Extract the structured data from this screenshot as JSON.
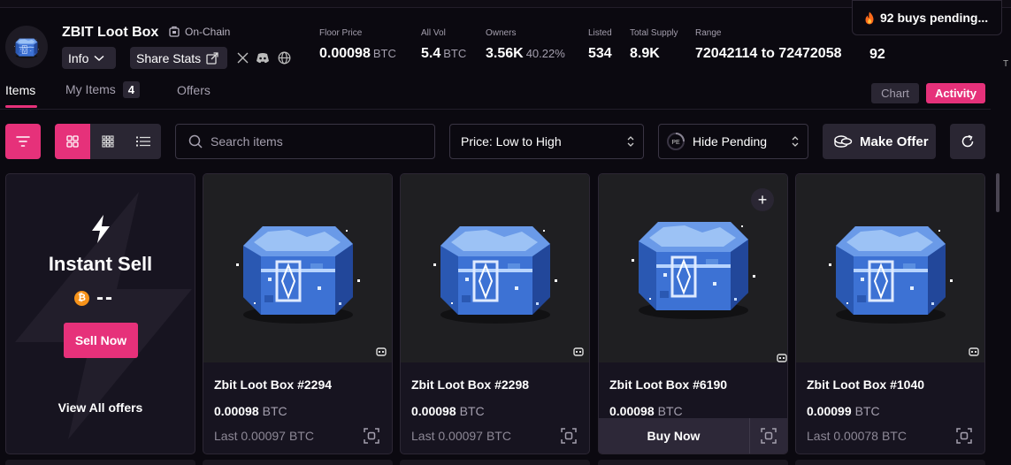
{
  "header": {
    "title": "ZBIT Loot Box",
    "onchain_label": "On-Chain",
    "info_label": "Info",
    "share_label": "Share Stats",
    "stats": {
      "floor": {
        "label": "Floor Price",
        "value": "0.00098",
        "unit": "BTC"
      },
      "vol": {
        "label": "All Vol",
        "value": "5.4",
        "unit": "BTC"
      },
      "owners": {
        "label": "Owners",
        "value": "3.56K",
        "percent": "40.22%"
      },
      "listed": {
        "label": "Listed",
        "value": "534"
      },
      "supply": {
        "label": "Total Supply",
        "value": "8.9K"
      },
      "range": {
        "label": "Range",
        "value": "72042114 to 72472058"
      }
    },
    "pending_label": "92 buys pending...",
    "pending_value": "92",
    "edge_letter": "T"
  },
  "tabs": {
    "items": "Items",
    "my_items": "My Items",
    "my_items_count": "4",
    "offers": "Offers",
    "chart": "Chart",
    "activity": "Activity"
  },
  "toolbar": {
    "search_placeholder": "Search items",
    "sort_value": "Price: Low to High",
    "pending_filter": "Hide Pending",
    "make_offer": "Make Offer"
  },
  "instant_sell": {
    "title": "Instant Sell",
    "btc_symbol": "₿",
    "price": "--",
    "sell_button": "Sell Now",
    "view_offers": "View All offers"
  },
  "cards": [
    {
      "name": "Zbit Loot Box #2294",
      "price": "0.00098",
      "unit": "BTC",
      "last_label": "Last",
      "last": "0.00097",
      "last_unit": "BTC"
    },
    {
      "name": "Zbit Loot Box #2298",
      "price": "0.00098",
      "unit": "BTC",
      "last_label": "Last",
      "last": "0.00097",
      "last_unit": "BTC"
    },
    {
      "name": "Zbit Loot Box #6190",
      "price": "0.00098",
      "unit": "BTC",
      "buy_label": "Buy Now",
      "add_symbol": "+"
    },
    {
      "name": "Zbit Loot Box #1040",
      "price": "0.00099",
      "unit": "BTC",
      "last_label": "Last",
      "last": "0.00078",
      "last_unit": "BTC"
    }
  ],
  "colors": {
    "accent": "#e6317a",
    "background": "#0b0910",
    "card": "#171420",
    "btc": "#f7931a"
  }
}
